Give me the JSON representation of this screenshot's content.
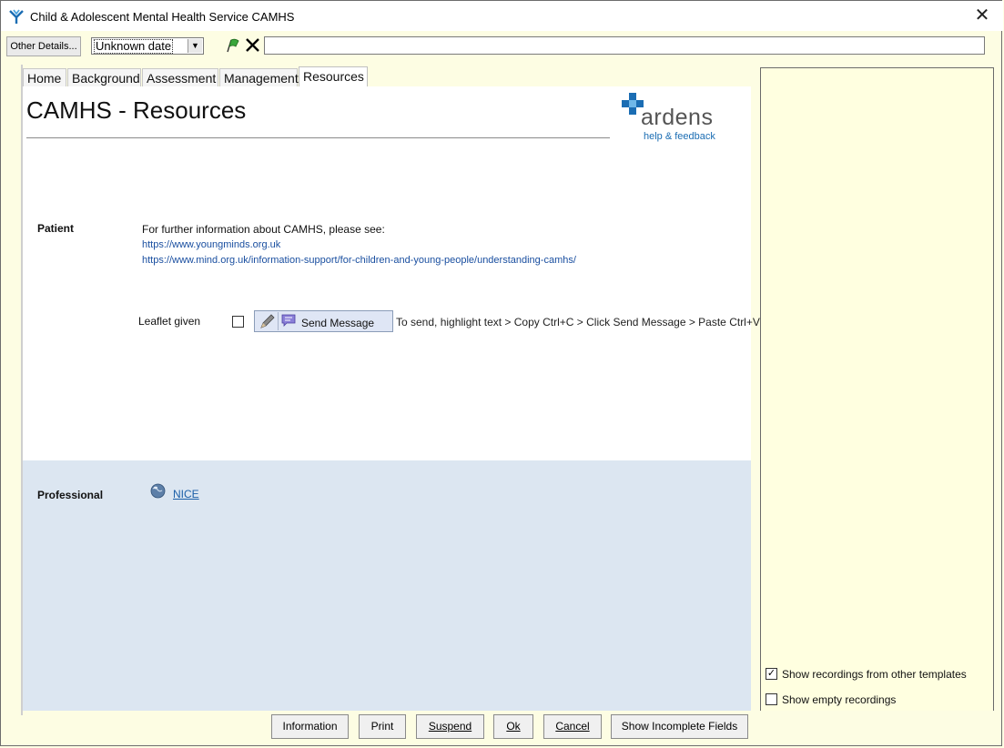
{
  "window": {
    "title": "Child & Adolescent Mental Health Service CAMHS"
  },
  "toolbar": {
    "other_details_label": "Other Details...",
    "date_value": "Unknown date",
    "text_value": ""
  },
  "tabs": [
    {
      "label": "Home",
      "active": false
    },
    {
      "label": "Background",
      "active": false
    },
    {
      "label": "Assessment",
      "active": false
    },
    {
      "label": "Management",
      "active": false
    },
    {
      "label": "Resources",
      "active": true
    }
  ],
  "page": {
    "title": "CAMHS - Resources",
    "logo_word": "ardens",
    "logo_sub": "help & feedback"
  },
  "patient": {
    "label": "Patient",
    "intro": "For further information about CAMHS, please see:",
    "links": [
      "https://www.youngminds.org.uk",
      "https://www.mind.org.uk/information-support/for-children-and-young-people/understanding-camhs/"
    ],
    "leaflet_label": "Leaflet given",
    "send_message_label": "Send Message",
    "hint": "To send, highlight text > Copy Ctrl+C > Click Send Message > Paste Ctrl+V"
  },
  "professional": {
    "label": "Professional",
    "link": "NICE"
  },
  "right_panel": {
    "show_other_templates": "Show recordings from other templates",
    "show_other_templates_checked": true,
    "show_empty": "Show empty recordings",
    "show_empty_checked": false
  },
  "buttons": {
    "information": "Information",
    "print": "Print",
    "suspend": "Suspend",
    "ok": "Ok",
    "cancel": "Cancel",
    "show_incomplete": "Show Incomplete Fields"
  },
  "colors": {
    "accent_blue": "#1b6db3",
    "panel_yellow": "#ffffe0",
    "professional_bg": "#dce6f1"
  }
}
